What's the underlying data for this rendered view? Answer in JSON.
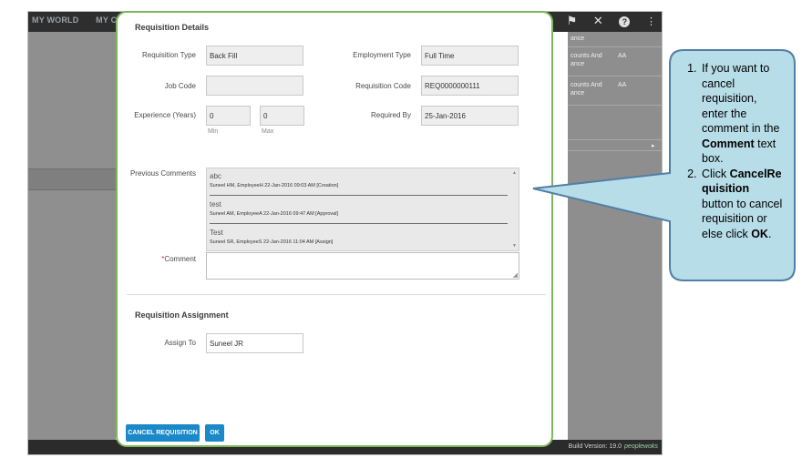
{
  "app": {
    "nav": [
      "MY WORLD",
      "MY COMPA"
    ],
    "icons": [
      "flag-icon",
      "tools-icon",
      "help-icon",
      "share-icon"
    ],
    "right_cells": [
      {
        "text": "ance",
        "col": 1
      },
      {
        "text": "counts And\nance",
        "col": 1
      },
      {
        "text": "AA",
        "col": 2
      },
      {
        "text": "counts And\nance",
        "col": 1
      },
      {
        "text": "AA",
        "col": 2
      }
    ],
    "right_arrow": "▸",
    "build_version": "Build Version: 19.0",
    "brand": "peoplewoks"
  },
  "modal": {
    "section1_title": "Requisition Details",
    "requisition_type_label": "Requisition Type",
    "requisition_type_value": "Back Fill",
    "employment_type_label": "Employment Type",
    "employment_type_value": "Full Time",
    "job_code_label": "Job Code",
    "job_code_value": "",
    "requisition_code_label": "Requisition Code",
    "requisition_code_value": "REQ0000000111",
    "experience_label": "Experience (Years)",
    "experience_min_value": "0",
    "experience_max_value": "0",
    "experience_min_label": "Min",
    "experience_max_label": "Max",
    "required_by_label": "Required By",
    "required_by_value": "25-Jan-2016",
    "previous_comments_label": "Previous Comments",
    "previous_comments": [
      {
        "text": "abc",
        "meta": "Suneel HM,  EmployeeH  22-Jan-2016 09:03 AM [Creation]"
      },
      {
        "text": "test",
        "meta": "Suneel AM,  EmployeeA  22-Jan-2016 09:47 AM [Approval]"
      },
      {
        "text": "Test",
        "meta": "Suneel SR,  EmployeeS  22-Jan-2016 11:04 AM [Assign]"
      }
    ],
    "comment_required_mark": "*",
    "comment_label": "Comment",
    "comment_value": "",
    "section2_title": "Requisition Assignment",
    "assign_to_label": "Assign To",
    "assign_to_value": "Suneel  JR",
    "cancel_button_label": "CANCEL REQUISITION",
    "ok_button_label": "OK"
  },
  "callout": {
    "step1_pre": "If you want to cancel requisition, enter the comment in the ",
    "step1_bold": "Comment",
    "step1_post": " text box.",
    "step2_pre": "Click ",
    "step2_bold": "CancelRequisition",
    "step2_mid": " button to cancel requisition or else click ",
    "step2_bold2": "OK",
    "step2_post": ".",
    "fill_color": "#b7dde8",
    "border_color": "#4f7fa7"
  }
}
